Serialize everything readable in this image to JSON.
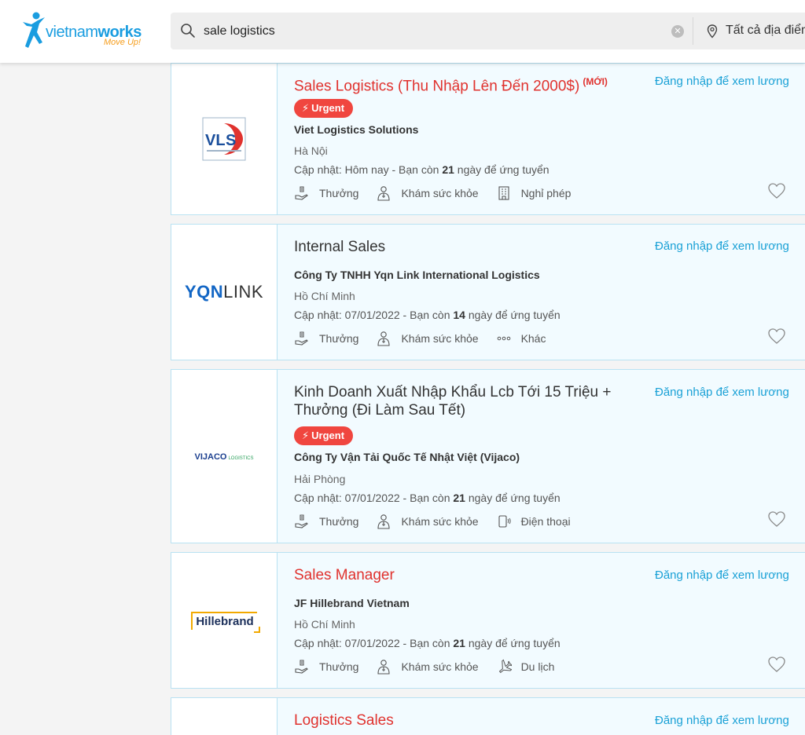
{
  "header": {
    "brand": "vietnamworks",
    "brand_prefix": "vietnam",
    "brand_suffix": "works",
    "tagline": "Move Up!",
    "search_value": "sale logistics",
    "location_label": "Tất cả địa điểm"
  },
  "jobs": [
    {
      "title": "Sales Logistics (Thu Nhập Lên Đến 2000$)",
      "title_color": "#e0322e",
      "new_badge": "(MỚI)",
      "salary": "Đăng nhập để xem lương",
      "urgent": "Urgent",
      "company": "Viet Logistics Solutions",
      "logo_text": "VLS",
      "location": "Hà Nội",
      "updated_prefix": "Cập nhật: Hôm nay - Bạn còn ",
      "days": "21",
      "updated_suffix": " ngày để ứng tuyển",
      "benefits": [
        "Thưởng",
        "Khám sức khỏe",
        "Nghỉ phép"
      ]
    },
    {
      "title": "Internal Sales",
      "title_color": "#333333",
      "salary": "Đăng nhập để xem lương",
      "company": "Công Ty TNHH Yqn Link International Logistics",
      "logo_text": "YQNLINK",
      "logo_text_bold": "YQN",
      "logo_text_light": "LINK",
      "location": "Hồ Chí Minh",
      "updated_prefix": "Cập nhật: 07/01/2022 - Bạn còn ",
      "days": "14",
      "updated_suffix": " ngày để ứng tuyển",
      "benefits": [
        "Thưởng",
        "Khám sức khỏe",
        "Khác"
      ]
    },
    {
      "title": "Kinh Doanh Xuất Nhập Khẩu Lcb Tới 15 Triệu + Thưởng (Đi Làm Sau Tết)",
      "title_color": "#333333",
      "salary": "Đăng nhập để xem lương",
      "urgent": "Urgent",
      "company": "Công Ty Vận Tải Quốc Tế Nhật Việt (Vijaco)",
      "logo_text": "VIJACO LOGISTICS",
      "logo_text_bold": "VIJACO",
      "logo_text_light": "LOGISTICS",
      "location": "Hải Phòng",
      "updated_prefix": "Cập nhật: 07/01/2022 - Bạn còn ",
      "days": "21",
      "updated_suffix": " ngày để ứng tuyển",
      "benefits": [
        "Thưởng",
        "Khám sức khỏe",
        "Điện thoại"
      ]
    },
    {
      "title": "Sales Manager",
      "title_color": "#e0322e",
      "salary": "Đăng nhập để xem lương",
      "company": "JF Hillebrand Vietnam",
      "logo_text": "Hillebrand",
      "location": "Hồ Chí Minh",
      "updated_prefix": "Cập nhật: 07/01/2022 - Bạn còn ",
      "days": "21",
      "updated_suffix": " ngày để ứng tuyển",
      "benefits": [
        "Thưởng",
        "Khám sức khỏe",
        "Du lịch"
      ]
    },
    {
      "title": "Logistics Sales",
      "title_color": "#e0322e",
      "salary": "Đăng nhập để xem lương"
    }
  ],
  "colors": {
    "accent_blue": "#1aa1d6",
    "urgent_red": "#f0463f",
    "card_bg": "#f2fbff",
    "card_border": "#b9e2f2",
    "brand_orange": "#f59c1a"
  }
}
